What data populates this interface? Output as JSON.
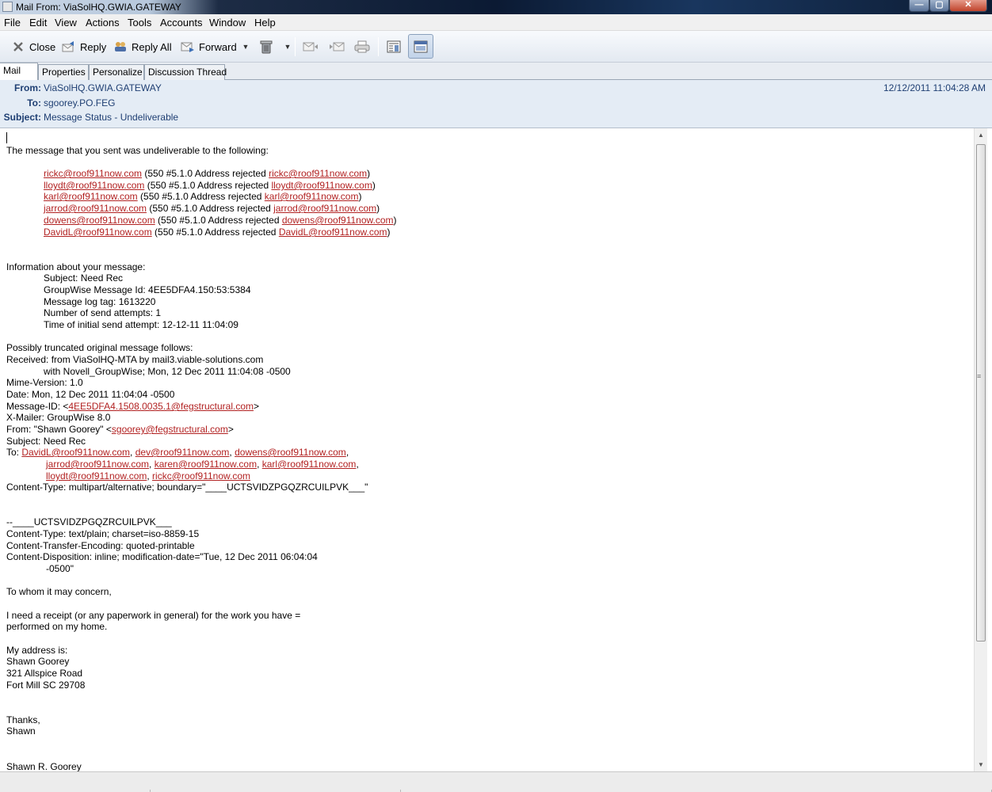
{
  "window": {
    "title": "Mail From: ViaSolHQ.GWIA.GATEWAY",
    "controls": {
      "minimize": "—",
      "maximize": "▢",
      "close": "✕"
    }
  },
  "menu": [
    "File",
    "Edit",
    "View",
    "Actions",
    "Tools",
    "Accounts",
    "Window",
    "Help"
  ],
  "toolbar": {
    "close_label": "Close",
    "reply_label": "Reply",
    "reply_all_label": "Reply All",
    "forward_label": "Forward",
    "icons": [
      "close-icon",
      "reply-icon",
      "reply-all-icon",
      "forward-icon",
      "dropdown-arrow-icon",
      "trash-icon",
      "dropdown-arrow-icon",
      "previous-item-icon",
      "next-item-icon",
      "print-icon",
      "show-fields-icon",
      "show-preview-icon"
    ]
  },
  "tabs": [
    "Mail",
    "Properties",
    "Personalize",
    "Discussion Thread"
  ],
  "header": {
    "from_label": "From:",
    "from_value": "ViaSolHQ.GWIA.GATEWAY",
    "to_label": "To:",
    "to_value": "sgoorey.PO.FEG",
    "subject_label": "Subject:",
    "subject_value": "Message Status - Undeliverable",
    "date": "12/12/2011 11:04:28 AM"
  },
  "body": {
    "intro": "The message that you sent was undeliverable to the following:",
    "undeliverable": [
      {
        "addr": "rickc@roof911now.com",
        "reason": " (550 #5.1.0 Address rejected ",
        "addr2": "rickc@roof911now.com",
        "close": ")"
      },
      {
        "addr": "lloydt@roof911now.com",
        "reason": " (550 #5.1.0 Address rejected ",
        "addr2": "lloydt@roof911now.com",
        "close": ")"
      },
      {
        "addr": "karl@roof911now.com",
        "reason": " (550 #5.1.0 Address rejected ",
        "addr2": "karl@roof911now.com",
        "close": ")"
      },
      {
        "addr": "jarrod@roof911now.com",
        "reason": " (550 #5.1.0 Address rejected ",
        "addr2": "jarrod@roof911now.com",
        "close": ")"
      },
      {
        "addr": "dowens@roof911now.com",
        "reason": " (550 #5.1.0 Address rejected ",
        "addr2": "dowens@roof911now.com",
        "close": ")"
      },
      {
        "addr": "DavidL@roof911now.com",
        "reason": " (550 #5.1.0 Address rejected ",
        "addr2": "DavidL@roof911now.com",
        "close": ")"
      }
    ],
    "info_heading": "Information about your message:",
    "info": [
      "Subject: Need Rec",
      "GroupWise Message Id: 4EE5DFA4.150:53:5384",
      "Message log tag: 1613220",
      "Number of send attempts: 1",
      "Time of initial send attempt: 12-12-11 11:04:09"
    ],
    "orig_heading": "Possibly truncated original message follows:",
    "received1": "Received: from ViaSolHQ-MTA by mail3.viable-solutions.com",
    "received2": "with Novell_GroupWise; Mon, 12 Dec 2011 11:04:08 -0500",
    "mime": "Mime-Version: 1.0",
    "date_line": "Date: Mon, 12 Dec 2011 11:04:04 -0500",
    "msgid_prefix": "Message-ID: <",
    "msgid_link": "4EE5DFA4.1508.0035.1@fegstructural.com",
    "msgid_suffix": ">",
    "xmailer": "X-Mailer: GroupWise 8.0",
    "from_prefix": "From: \"Shawn Goorey\" <",
    "from_link": "sgoorey@fegstructural.com",
    "from_suffix": ">",
    "subject_line": "Subject: Need Rec",
    "to_prefix": "To: ",
    "to_line1": [
      "DavidL@roof911now.com",
      "dev@roof911now.com",
      "dowens@roof911now.com"
    ],
    "to_line2": [
      "jarrod@roof911now.com",
      "karen@roof911now.com",
      "karl@roof911now.com"
    ],
    "to_line3": [
      "lloydt@roof911now.com",
      "rickc@roof911now.com"
    ],
    "content_type": "Content-Type: multipart/alternative; boundary=\"____UCTSVIDZPGQZRCUILPVK___\"",
    "boundary": "--____UCTSVIDZPGQZRCUILPVK___",
    "ct_plain": "Content-Type: text/plain; charset=iso-8859-15",
    "cte": "Content-Transfer-Encoding: quoted-printable",
    "cd1": "Content-Disposition: inline; modification-date=\"Tue, 12 Dec 2011 06:04:04",
    "cd2": "-0500\"",
    "greeting": "To whom it may concern,",
    "para1": "I need a receipt (or any paperwork in general) for the work you have =",
    "para2": "performed on my home.",
    "addr_heading": "My address is:",
    "addr_name": "Shawn Goorey",
    "addr_street": "321 Allspice Road",
    "addr_city": "Fort Mill SC 29708",
    "thanks": "Thanks,",
    "sign": "Shawn",
    "sig_full": "Shawn R. Goorey"
  }
}
